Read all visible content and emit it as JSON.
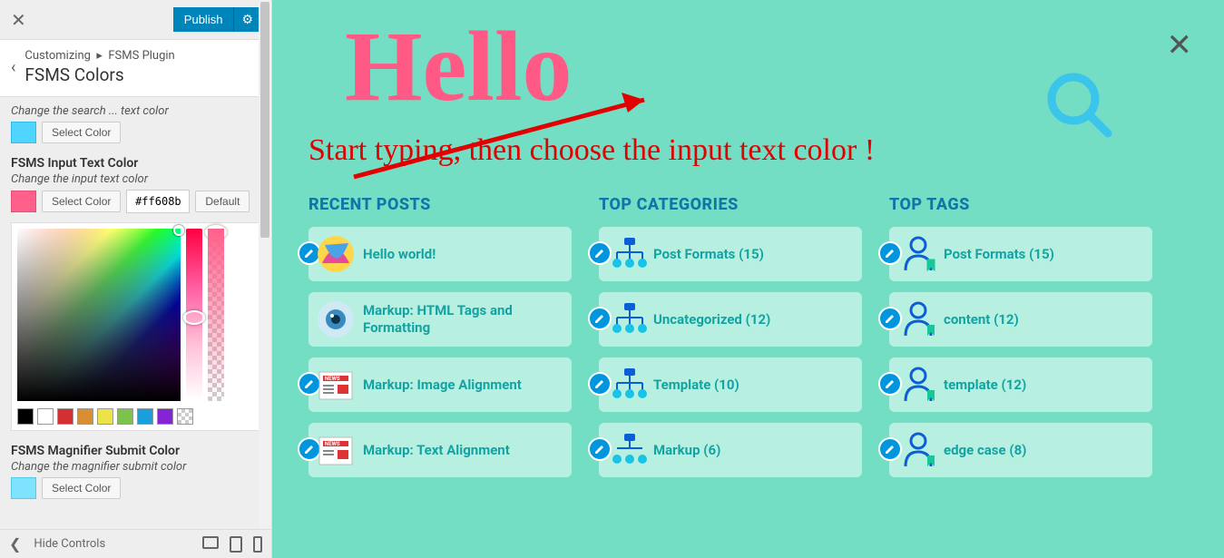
{
  "sidebar": {
    "publish_label": "Publish",
    "breadcrumb_root": "Customizing",
    "breadcrumb_parent": "FSMS Plugin",
    "panel_title": "FSMS Colors",
    "setting_search": {
      "desc": "Change the search ... text color",
      "button": "Select Color"
    },
    "setting_input": {
      "label": "FSMS Input Text Color",
      "desc": "Change the input text color",
      "button": "Select Color",
      "hex": "#ff608b",
      "default_label": "Default"
    },
    "swatch_colors": [
      "#000000",
      "#ffffff",
      "#d33034",
      "#d88f33",
      "#ece346",
      "#7dc24b",
      "#1a9edc",
      "#8623d4"
    ],
    "setting_magnifier": {
      "label": "FSMS Magnifier Submit Color",
      "desc": "Change the magnifier submit color",
      "button": "Select Color"
    },
    "hide_controls": "Hide Controls"
  },
  "preview": {
    "search_value": "Hello",
    "annotation": "Start typing, then choose the input text color !",
    "columns": {
      "recent": {
        "title": "RECENT POSTS",
        "items": [
          "Hello world!",
          "Markup: HTML Tags and Formatting",
          "Markup: Image Alignment",
          "Markup: Text Alignment"
        ]
      },
      "categories": {
        "title": "TOP CATEGORIES",
        "items": [
          "Post Formats (15)",
          "Uncategorized (12)",
          "Template (10)",
          "Markup (6)"
        ]
      },
      "tags": {
        "title": "TOP TAGS",
        "items": [
          "Post Formats (15)",
          "content (12)",
          "template (12)",
          "edge case (8)"
        ]
      }
    }
  }
}
